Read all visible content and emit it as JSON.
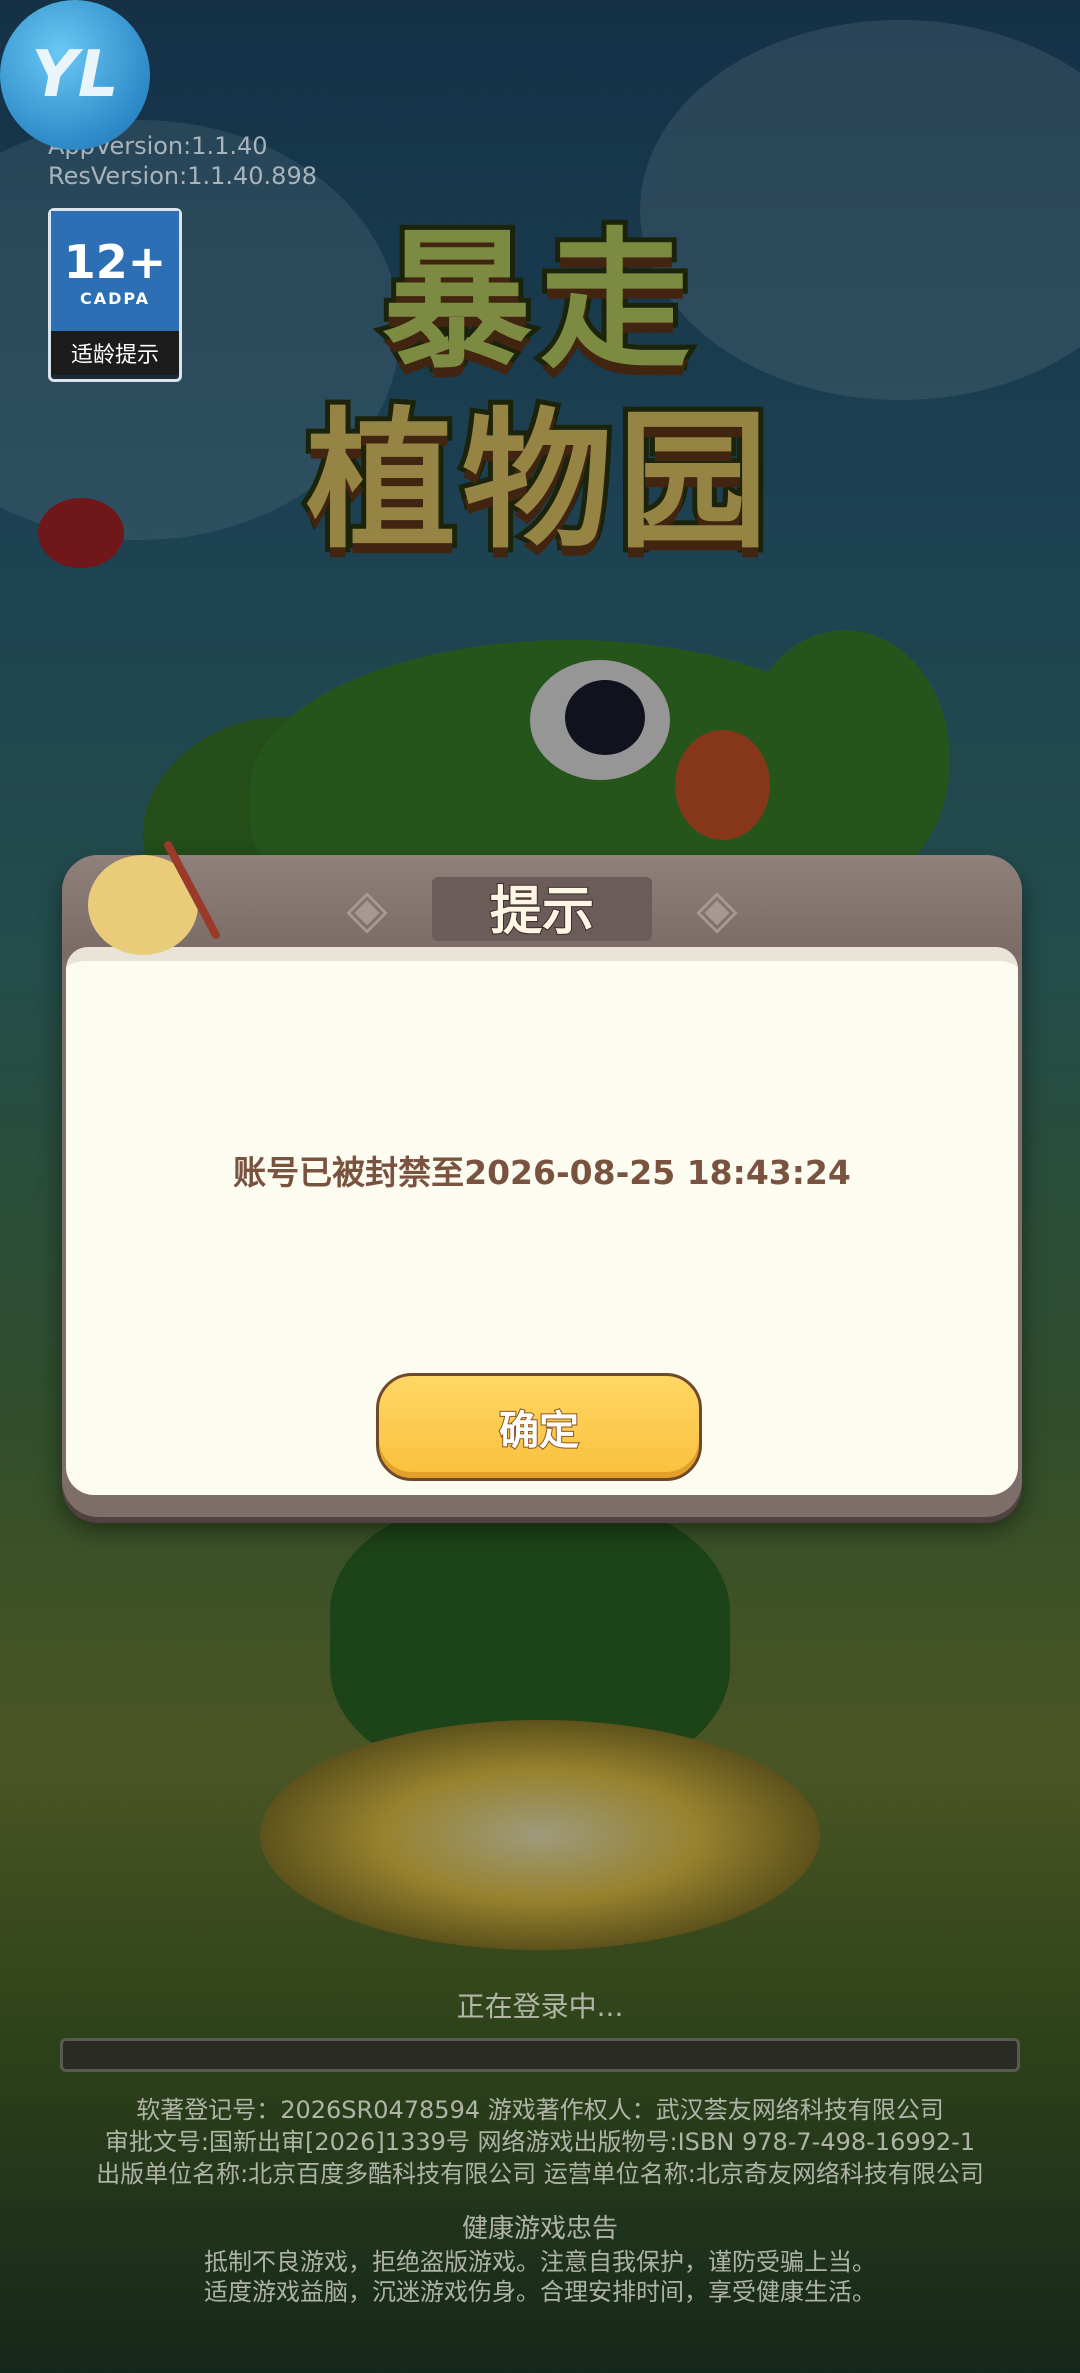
{
  "app": {
    "floating_logo_text": "YL",
    "app_version": "AppVersion:1.1.40",
    "res_version": "ResVersion:1.1.40.898",
    "age_rating": {
      "number": "12+",
      "org": "CADPA",
      "label": "适龄提示"
    },
    "logo_line1": "暴走",
    "logo_line2": "植物园"
  },
  "dialog": {
    "title": "提示",
    "message": "账号已被封禁至2026-08-25 18:43:24",
    "confirm_label": "确定"
  },
  "loading": {
    "text": "正在登录中...",
    "progress": 0
  },
  "footer": {
    "lines": [
      "软著登记号：2026SR0478594  游戏著作权人：武汉荟友网络科技有限公司",
      "审批文号:国新出审[2026]1339号  网络游戏出版物号:ISBN 978-7-498-16992-1",
      "出版单位名称:北京百度多酷科技有限公司  运营单位名称:北京奇友网络科技有限公司"
    ],
    "health_title": "健康游戏忠告",
    "health_lines": [
      "抵制不良游戏，拒绝盗版游戏。注意自我保护，谨防受骗上当。",
      "适度游戏益脑，沉迷游戏伤身。合理安排时间，享受健康生活。"
    ]
  }
}
